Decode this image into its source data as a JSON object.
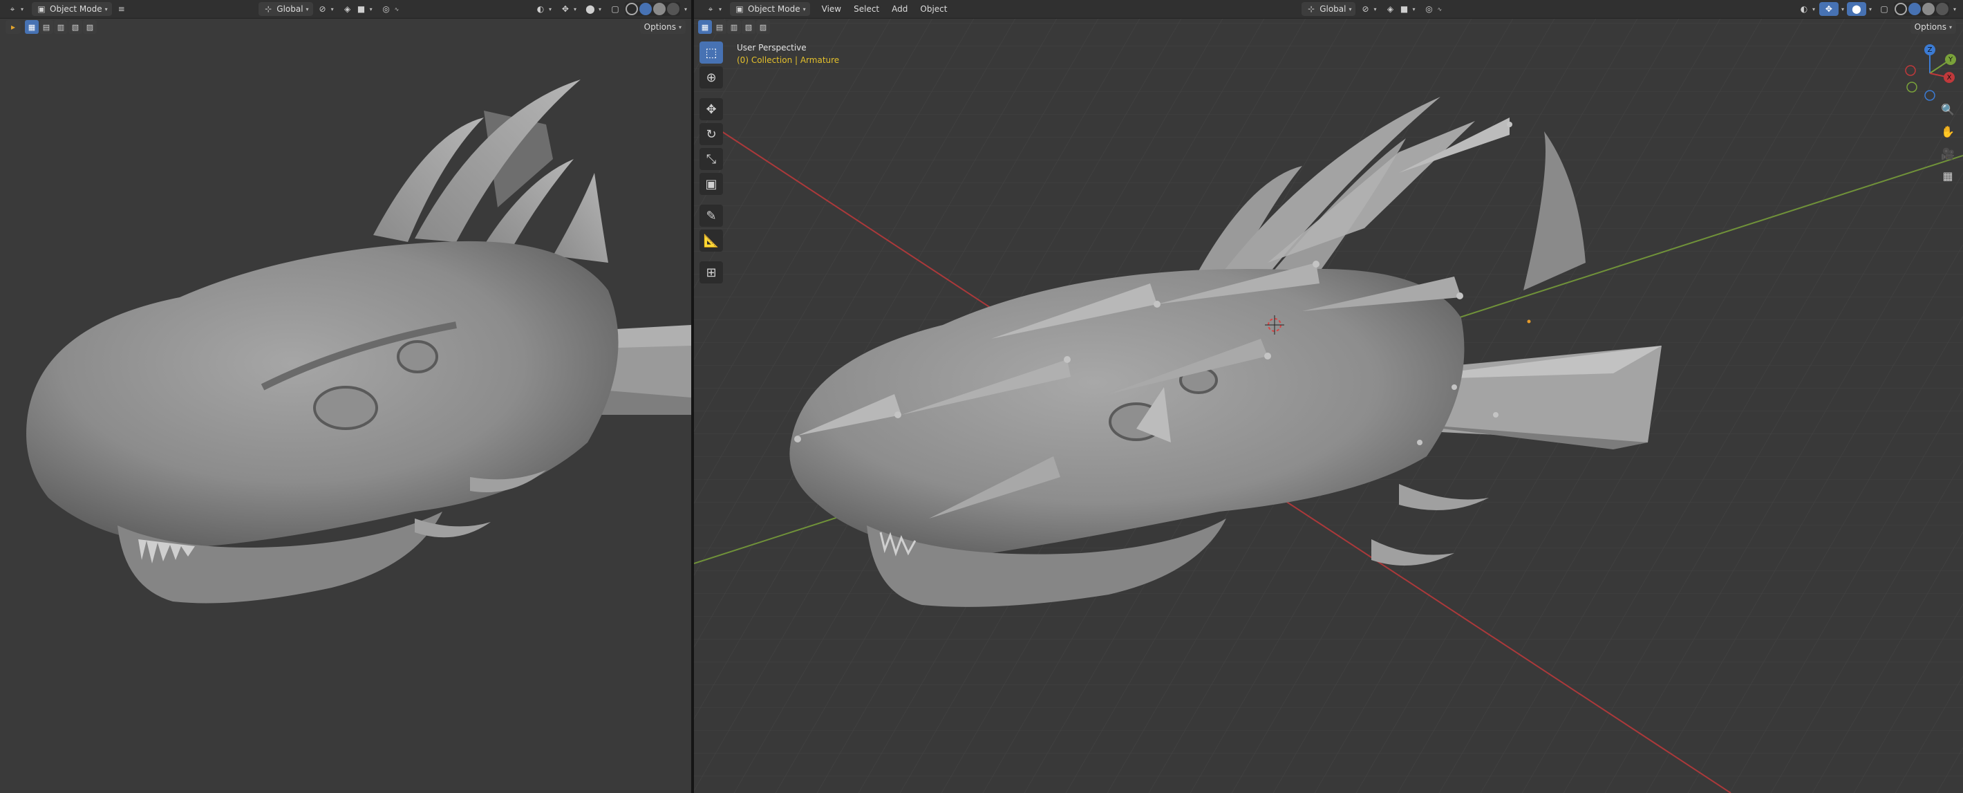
{
  "left_view": {
    "header": {
      "mode_label": "Object Mode",
      "orientation_label": "Global"
    },
    "options_label": "Options",
    "icons": [
      "editor-type-icon",
      "object-mode-icon",
      "hamburger-menu-icon",
      "orientation-icon",
      "pivot-icon",
      "snap-icon",
      "proportional-icon",
      "visibility-icon",
      "gizmo-icon",
      "overlay-icon",
      "xray-icon",
      "shading-wireframe-icon",
      "shading-solid-icon",
      "shading-material-icon",
      "shading-rendered-icon"
    ]
  },
  "right_view": {
    "header": {
      "mode_label": "Object Mode",
      "menus": [
        "View",
        "Select",
        "Add",
        "Object"
      ],
      "orientation_label": "Global"
    },
    "options_label": "Options",
    "overlay": {
      "perspective_label": "User Perspective",
      "collection_label": "(0) Collection | Armature"
    },
    "tools": [
      "select-box-icon",
      "cursor-icon",
      "move-icon",
      "rotate-icon",
      "scale-icon",
      "transform-icon",
      "annotate-icon",
      "measure-icon",
      "add-cube-icon"
    ],
    "gizmo_axes": [
      "X",
      "Y",
      "Z"
    ],
    "nav_icons": [
      "zoom-icon",
      "pan-hand-icon",
      "camera-icon",
      "grid-view-icon"
    ]
  },
  "colors": {
    "accent": "#4772b3",
    "header_bg": "#303030",
    "viewport_bg": "#3a3a3a",
    "axis_x": "#c0393b",
    "axis_y": "#7aa23a",
    "axis_z": "#3b7bd4",
    "collection_text": "#e4c02c"
  }
}
